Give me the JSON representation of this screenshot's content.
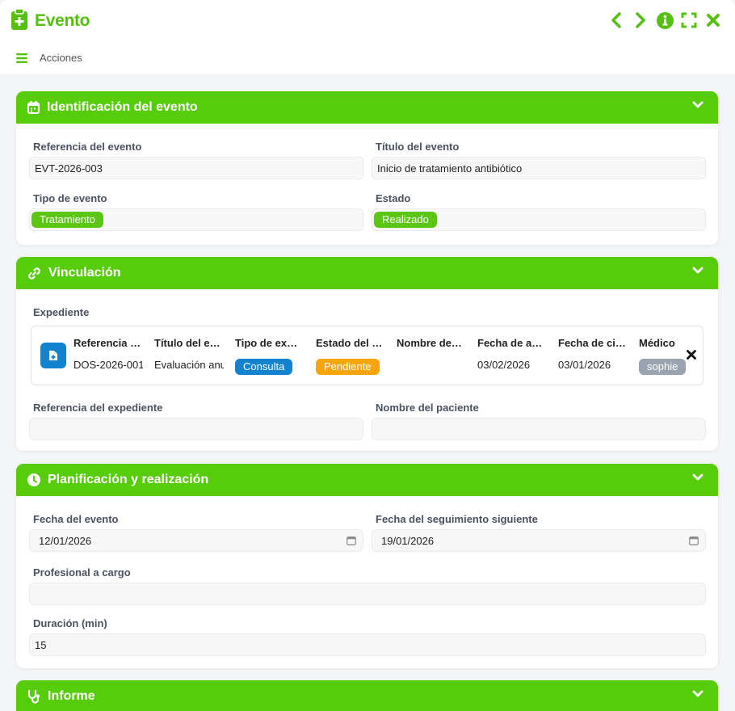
{
  "app": {
    "title": "Evento"
  },
  "actions": {
    "label": "Acciones"
  },
  "colors": {
    "accent": "#56cc0a",
    "blue": "#1283cf",
    "orange": "#f7a50c",
    "gray": "#99a4b0"
  },
  "sections": {
    "identification": {
      "title": "Identificación del evento",
      "reference_label": "Referencia del evento",
      "reference_value": "EVT-2026-003",
      "title_label": "Título del evento",
      "title_value": "Inicio de tratamiento antibiótico",
      "type_label": "Tipo de evento",
      "type_value": "Tratamiento",
      "status_label": "Estado",
      "status_value": "Realizado"
    },
    "linking": {
      "title": "Vinculación",
      "file_label": "Expediente",
      "linked_record": {
        "columns": [
          {
            "header": "Referencia del expediente",
            "value": "DOS-2026-001",
            "kind": "text"
          },
          {
            "header": "Título del expediente",
            "value": "Evaluación anual",
            "kind": "text"
          },
          {
            "header": "Tipo de expediente",
            "value": "Consulta",
            "kind": "pill-blue"
          },
          {
            "header": "Estado del expediente",
            "value": "Pendiente",
            "kind": "pill-orange"
          },
          {
            "header": "Nombre del paciente",
            "value": "",
            "kind": "text"
          },
          {
            "header": "Fecha de apertura",
            "value": "03/02/2026",
            "kind": "text"
          },
          {
            "header": "Fecha de cierre",
            "value": "03/01/2026",
            "kind": "text"
          },
          {
            "header": "Médico",
            "value": "sophie",
            "kind": "pill-gray"
          }
        ]
      },
      "file_reference_label": "Referencia del expediente",
      "file_reference_value": "",
      "patient_name_label": "Nombre del paciente",
      "patient_name_value": ""
    },
    "planning": {
      "title": "Planificación y realización",
      "event_date_label": "Fecha del evento",
      "event_date_value": "12/01/2026",
      "followup_date_label": "Fecha del seguimiento siguiente",
      "followup_date_value": "19/01/2026",
      "professional_label": "Profesional a cargo",
      "professional_value": "",
      "duration_label": "Duración (min)",
      "duration_value": "15"
    },
    "report": {
      "title": "Informe"
    }
  }
}
